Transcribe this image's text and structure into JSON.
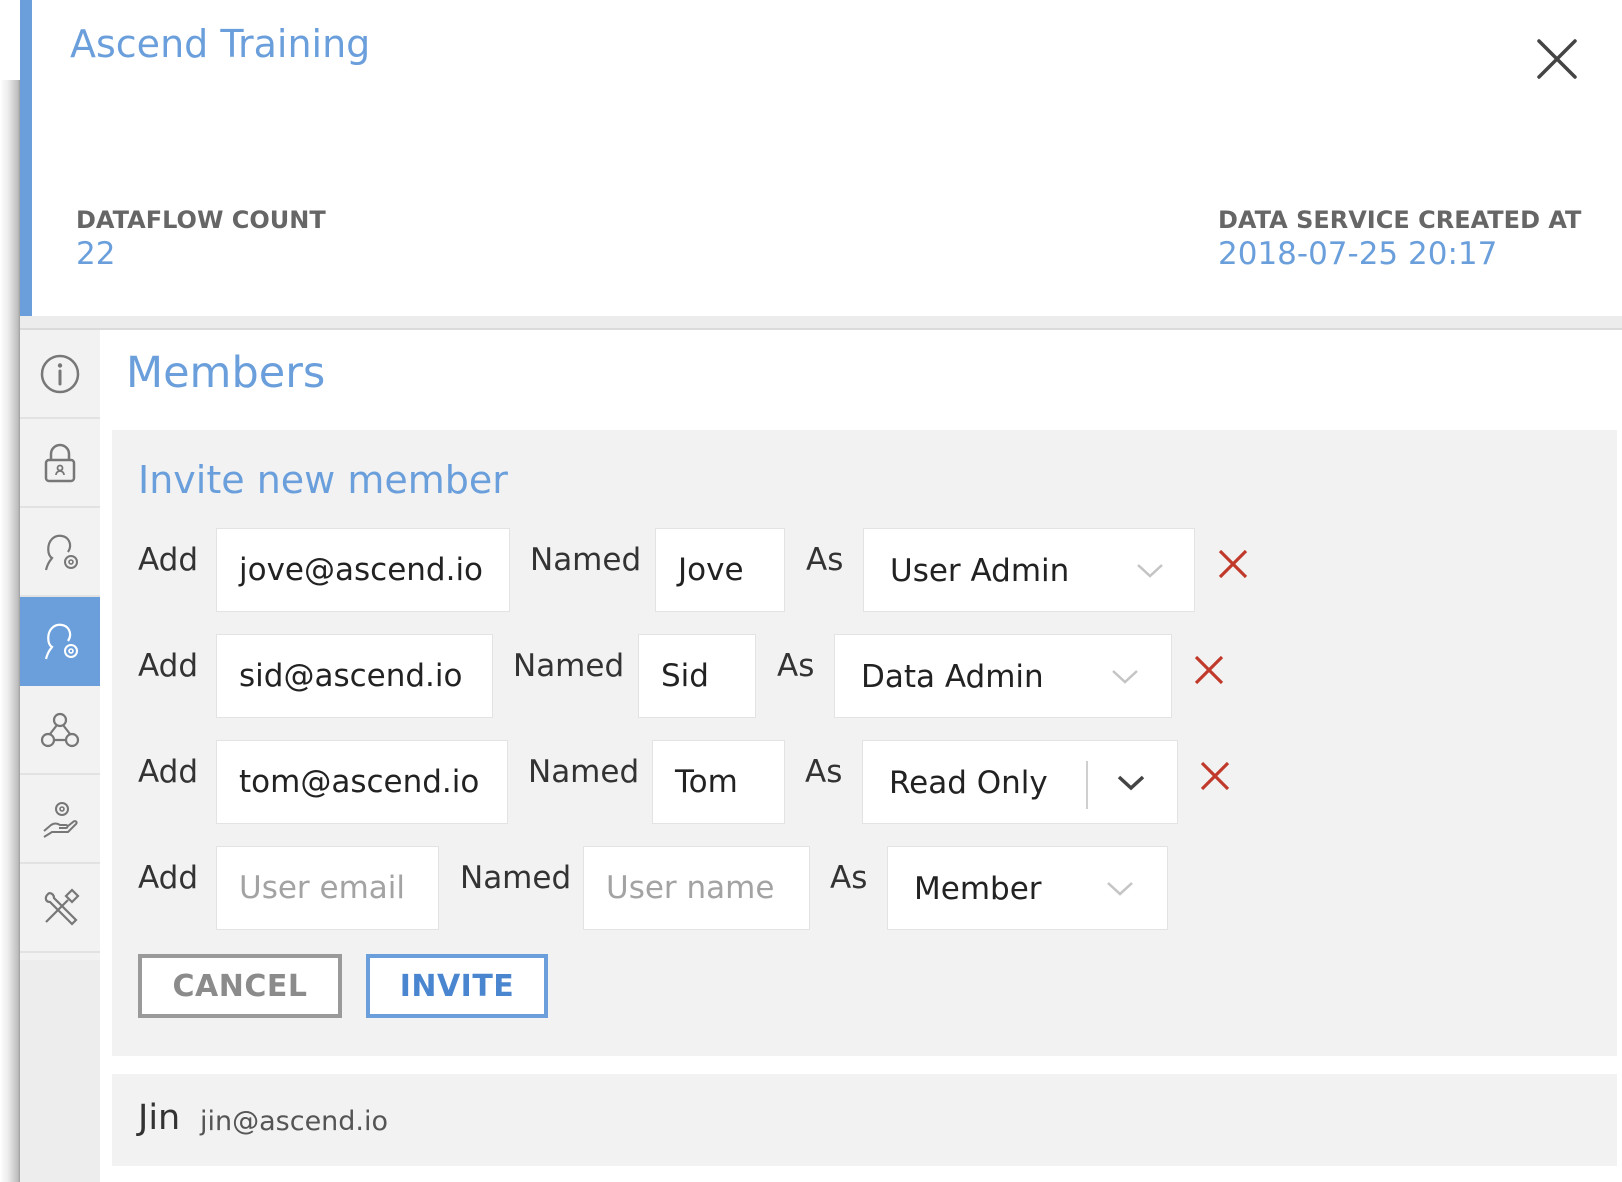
{
  "header": {
    "title": "Ascend Training",
    "stats": [
      {
        "label": "DATAFLOW COUNT",
        "value": "22"
      },
      {
        "label": "DATA SERVICE CREATED AT",
        "value": "2018-07-25 20:17"
      }
    ]
  },
  "sidebar": {
    "items": [
      {
        "icon": "info-icon",
        "active": false
      },
      {
        "icon": "lock-icon",
        "active": false
      },
      {
        "icon": "user-settings-icon",
        "active": false
      },
      {
        "icon": "members-icon",
        "active": true
      },
      {
        "icon": "webhook-icon",
        "active": false
      },
      {
        "icon": "service-hand-icon",
        "active": false
      },
      {
        "icon": "tools-icon",
        "active": false
      }
    ]
  },
  "members": {
    "title": "Members",
    "invite": {
      "title": "Invite new member",
      "add_label": "Add",
      "named_label": "Named",
      "as_label": "As",
      "rows": [
        {
          "email": "jove@ascend.io",
          "name": "Jove",
          "role": "User Admin"
        },
        {
          "email": "sid@ascend.io",
          "name": "Sid",
          "role": "Data Admin"
        },
        {
          "email": "tom@ascend.io",
          "name": "Tom",
          "role": "Read Only"
        }
      ],
      "new_row": {
        "email_placeholder": "User email",
        "name_placeholder": "User name",
        "role": "Member"
      },
      "cancel_label": "CANCEL",
      "invite_label": "INVITE"
    },
    "list": [
      {
        "name": "Jin",
        "email": "jin@ascend.io"
      }
    ]
  },
  "colors": {
    "accent": "#6a9fdc",
    "remove": "#c0392b"
  }
}
